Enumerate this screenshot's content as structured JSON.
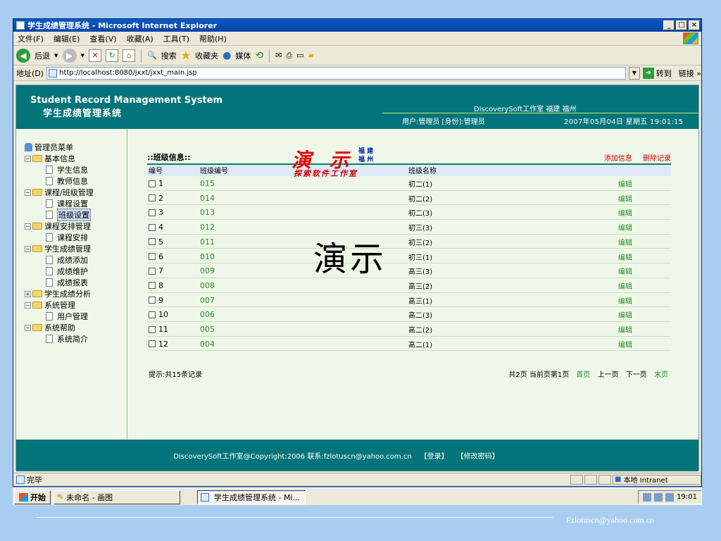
{
  "window": {
    "title": "学生成绩管理系统 - Microsoft Internet Explorer",
    "minimize": "_",
    "maximize": "□",
    "close": "×"
  },
  "menu": [
    "文件(F)",
    "编辑(E)",
    "查看(V)",
    "收藏(A)",
    "工具(T)",
    "帮助(H)"
  ],
  "toolbar": {
    "back": "后退",
    "search": "搜索",
    "favorites": "收藏夹",
    "media": "媒体"
  },
  "address": {
    "label": "地址(D)",
    "url": "http://localhost:8080/jxxt/jxxt_main.jsp",
    "go": "转到",
    "links": "链接 »"
  },
  "site": {
    "title_en": "Student Record Management System",
    "title_cn": "学生成绩管理系统",
    "studio": "DiscoverySoft工作室 福建 福州",
    "user": "用户:管理员 [身份]:管理员",
    "datetime": "2007年05月04日 星期五 19:01:15",
    "footer_copyright": "DiscoverySoft工作室@Copyright:2006 联系:fzlotuscn@yahoo.com.cn",
    "footer_login": "【登录】",
    "footer_change_pwd": "【修改密码】"
  },
  "sidebar": {
    "root": "管理员菜单",
    "groups": [
      {
        "label": "基本信息",
        "items": [
          "学生信息",
          "教师信息"
        ]
      },
      {
        "label": "课程/班级管理",
        "items": [
          "课程设置",
          "班级设置"
        ]
      },
      {
        "label": "课程安排管理",
        "items": [
          "课程安排"
        ]
      },
      {
        "label": "学生成绩管理",
        "items": [
          "成绩添加",
          "成绩维护",
          "成绩报表"
        ]
      },
      {
        "label": "学生成绩分析",
        "items": []
      },
      {
        "label": "系统管理",
        "items": [
          "用户管理"
        ]
      },
      {
        "label": "系统帮助",
        "items": [
          "系统简介"
        ]
      }
    ],
    "selected": "班级设置"
  },
  "main": {
    "title": "::班级信息::",
    "add": "添加信息",
    "delete": "删除记录",
    "columns": {
      "no": "编号",
      "code": "班级编号",
      "name": "班级名称"
    },
    "rows": [
      {
        "no": "1",
        "code": "015",
        "name": "初二(1)",
        "op": "编辑"
      },
      {
        "no": "2",
        "code": "014",
        "name": "初二(2)",
        "op": "编辑"
      },
      {
        "no": "3",
        "code": "013",
        "name": "初二(3)",
        "op": "编辑"
      },
      {
        "no": "4",
        "code": "012",
        "name": "初三(3)",
        "op": "编辑"
      },
      {
        "no": "5",
        "code": "011",
        "name": "初三(2)",
        "op": "编辑"
      },
      {
        "no": "6",
        "code": "010",
        "name": "初三(1)",
        "op": "编辑"
      },
      {
        "no": "7",
        "code": "009",
        "name": "高三(3)",
        "op": "编辑"
      },
      {
        "no": "8",
        "code": "008",
        "name": "高三(2)",
        "op": "编辑"
      },
      {
        "no": "9",
        "code": "007",
        "name": "高三(1)",
        "op": "编辑"
      },
      {
        "no": "10",
        "code": "006",
        "name": "高二(3)",
        "op": "编辑"
      },
      {
        "no": "11",
        "code": "005",
        "name": "高二(2)",
        "op": "编辑"
      },
      {
        "no": "12",
        "code": "004",
        "name": "高二(1)",
        "op": "编辑"
      }
    ],
    "summary": "提示:共15条记录",
    "pager": {
      "info": "共2页 当前页第1页",
      "first": "首页",
      "prev": "上一页",
      "next": "下一页",
      "last": "末页"
    }
  },
  "watermark": {
    "big_red": "演 示",
    "sub_line1": "福 建",
    "sub_line2": "福 州",
    "tagline": "探索软件工作室",
    "big_black": "演示"
  },
  "status": {
    "text": "完毕",
    "zone": "本地 Intranet"
  },
  "taskbar": {
    "start": "开始",
    "task1": "未命名 - 画图",
    "task2": "学生成绩管理系统 - Mi...",
    "clock": "19:01"
  },
  "slide_footer": "Fzlotuscn@yahoo.com.cn"
}
